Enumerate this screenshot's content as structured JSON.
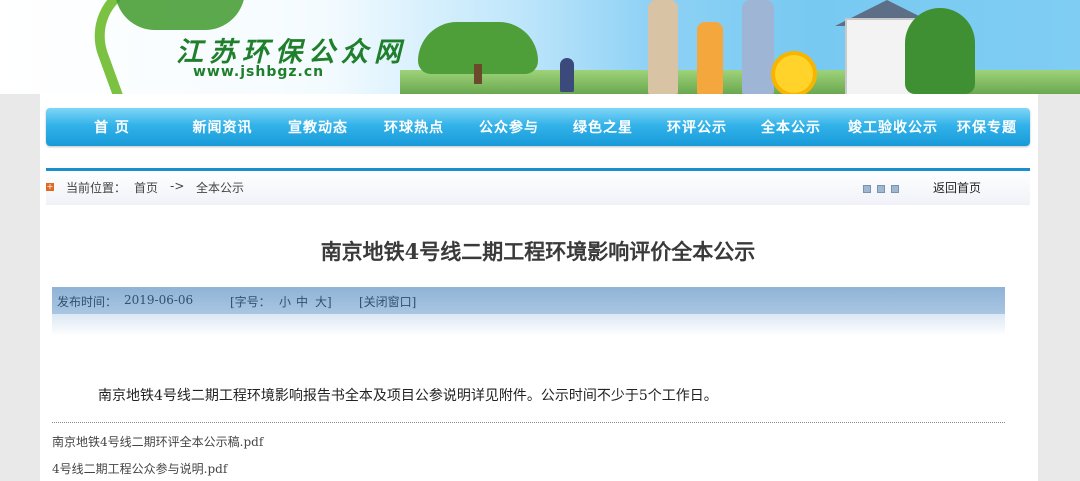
{
  "banner": {
    "site_name": "江苏环保公众网",
    "site_url": "www.jshbgz.cn"
  },
  "nav": {
    "items": [
      {
        "label": "首  页"
      },
      {
        "label": "新闻资讯"
      },
      {
        "label": "宣教动态"
      },
      {
        "label": "环球热点"
      },
      {
        "label": "公众参与"
      },
      {
        "label": "绿色之星"
      },
      {
        "label": "环评公示"
      },
      {
        "label": "全本公示"
      },
      {
        "label": "竣工验收公示"
      },
      {
        "label": "环保专题"
      }
    ]
  },
  "breadcrumb": {
    "label": "当前位置：",
    "home": "首页",
    "separator": "->",
    "current": "全本公示",
    "back_home": "返回首页"
  },
  "article": {
    "title": "南京地铁4号线二期工程环境影响评价全本公示",
    "publish_label": "发布时间：",
    "publish_date": "2019-06-06",
    "font_size_label": "[字号：",
    "font_small": "小",
    "font_medium": "中",
    "font_large": "大]",
    "close_window": "[关闭窗口]",
    "body": "南京地铁4号线二期工程环境影响报告书全本及项目公参说明详见附件。公示时间不少于5个工作日。",
    "attachments": [
      "南京地铁4号线二期环评全本公示稿.pdf",
      "4号线二期工程公众参与说明.pdf"
    ]
  },
  "colors": {
    "nav_top": "#7fd6f6",
    "nav_bottom": "#169ad8",
    "accent_line": "#1a8fd0",
    "meta_bar": "#8fb3d6",
    "logo_green": "#1f7f2b"
  }
}
